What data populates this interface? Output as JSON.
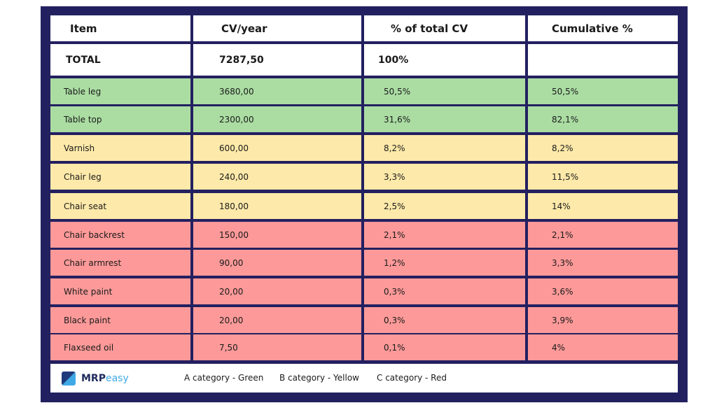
{
  "table": {
    "headers": [
      "Item",
      "CV/year",
      "% of total CV",
      "Cumulative %"
    ],
    "total": {
      "item": "TOTAL",
      "cv": "7287,50",
      "pct": "100%",
      "cum": ""
    },
    "rows": [
      {
        "item": "Table leg",
        "cv": "3680,00",
        "pct": "50,5%",
        "cum": "50,5%",
        "category": "A"
      },
      {
        "item": "Table top",
        "cv": "2300,00",
        "pct": "31,6%",
        "cum": "82,1%",
        "category": "A"
      },
      {
        "item": "Varnish",
        "cv": "600,00",
        "pct": "8,2%",
        "cum": "8,2%",
        "category": "B"
      },
      {
        "item": "Chair leg",
        "cv": "240,00",
        "pct": "3,3%",
        "cum": "11,5%",
        "category": "B"
      },
      {
        "item": "Chair seat",
        "cv": "180,00",
        "pct": "2,5%",
        "cum": "14%",
        "category": "B"
      },
      {
        "item": "Chair backrest",
        "cv": "150,00",
        "pct": "2,1%",
        "cum": "2,1%",
        "category": "C"
      },
      {
        "item": "Chair armrest",
        "cv": "90,00",
        "pct": "1,2%",
        "cum": "3,3%",
        "category": "C"
      },
      {
        "item": "White paint",
        "cv": "20,00",
        "pct": "0,3%",
        "cum": "3,6%",
        "category": "C"
      },
      {
        "item": "Black paint",
        "cv": "20,00",
        "pct": "0,3%",
        "cum": "3,9%",
        "category": "C"
      },
      {
        "item": "Flaxseed oil",
        "cv": "7,50",
        "pct": "0,1%",
        "cum": "4%",
        "category": "C"
      }
    ]
  },
  "colors": {
    "frame": "#232060",
    "A": "#abdda3",
    "B": "#fde9a9",
    "C": "#fd9a99"
  },
  "footer": {
    "logo_bold": "MRP",
    "logo_light": "easy",
    "legend": [
      "A category - Green",
      "B category - Yellow",
      "C category - Red"
    ]
  }
}
